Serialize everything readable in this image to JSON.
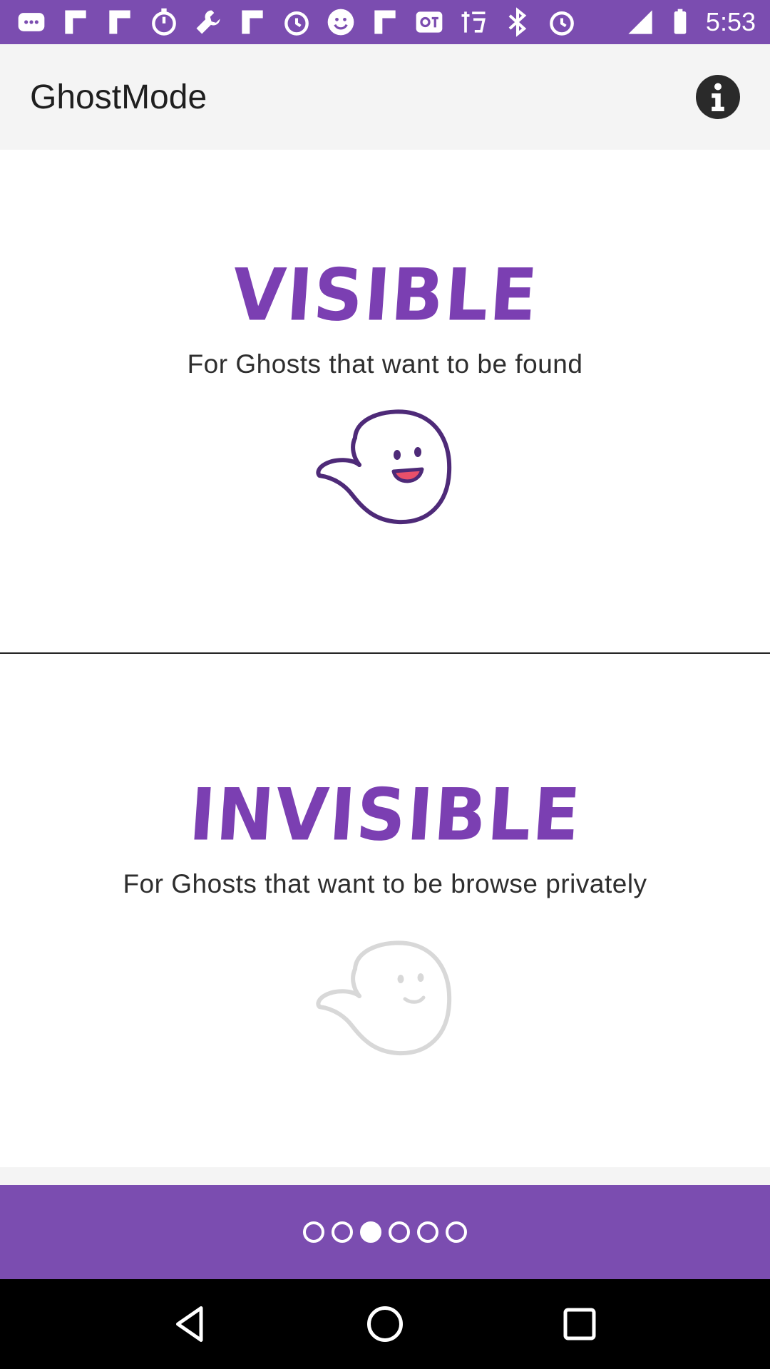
{
  "status_bar": {
    "time": "5:53",
    "icons": [
      "messages-icon",
      "flipboard-icon",
      "flipboard-icon",
      "stopwatch-icon",
      "wrench-icon",
      "flipboard-icon",
      "alarm-icon",
      "smiley-icon",
      "flipboard-icon",
      "qq-icon",
      "taobao-icon",
      "bluetooth-icon",
      "alarm-icon"
    ]
  },
  "app_bar": {
    "title": "GhostMode"
  },
  "modes": {
    "visible": {
      "title": "VISIBLE",
      "subtitle": "For Ghosts that want to be found"
    },
    "invisible": {
      "title": "INVISIBLE",
      "subtitle": "For Ghosts that want to be browse privately"
    }
  },
  "pager": {
    "count": 6,
    "active_index": 2
  },
  "colors": {
    "accent": "#7b4db0",
    "title_purple": "#7b3fb2",
    "ghost_outline": "#4e2a78",
    "ghost_inactive": "#d8d8d8",
    "mouth": "#e9506a"
  }
}
